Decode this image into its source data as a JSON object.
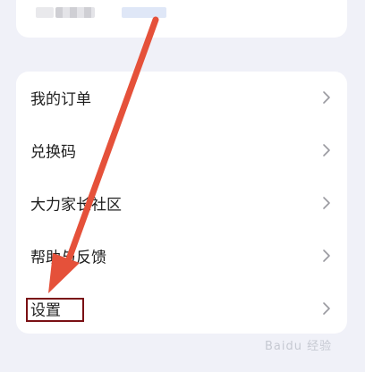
{
  "menu": {
    "items": [
      {
        "label": "我的订单"
      },
      {
        "label": "兑换码"
      },
      {
        "label": "大力家长社区"
      },
      {
        "label": "帮助与反馈"
      },
      {
        "label": "设置"
      }
    ]
  },
  "annotation": {
    "arrow_color": "#e5513a",
    "highlight_color": "#7a1014",
    "chevron_color": "#9a9aa0"
  },
  "watermark": {
    "text": "Baidu 经验"
  },
  "icons": {
    "chevron": "chevron-right-icon"
  }
}
